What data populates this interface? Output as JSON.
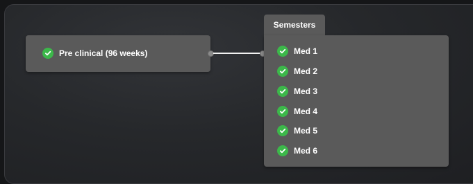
{
  "source_node": {
    "label": "Pre clinical (96 weeks)",
    "icon": "check-circle-icon",
    "status_color": "#3cb84a"
  },
  "target_node": {
    "tab_label": "Semesters",
    "items": [
      {
        "label": "Med 1",
        "icon": "check-circle-icon"
      },
      {
        "label": "Med 2",
        "icon": "check-circle-icon"
      },
      {
        "label": "Med 3",
        "icon": "check-circle-icon"
      },
      {
        "label": "Med 4",
        "icon": "check-circle-icon"
      },
      {
        "label": "Med 5",
        "icon": "check-circle-icon"
      },
      {
        "label": "Med 6",
        "icon": "check-circle-icon"
      }
    ]
  },
  "colors": {
    "node_background": "#5a5a5a",
    "edge": "#f2f2f2",
    "check": "#3cb84a"
  }
}
